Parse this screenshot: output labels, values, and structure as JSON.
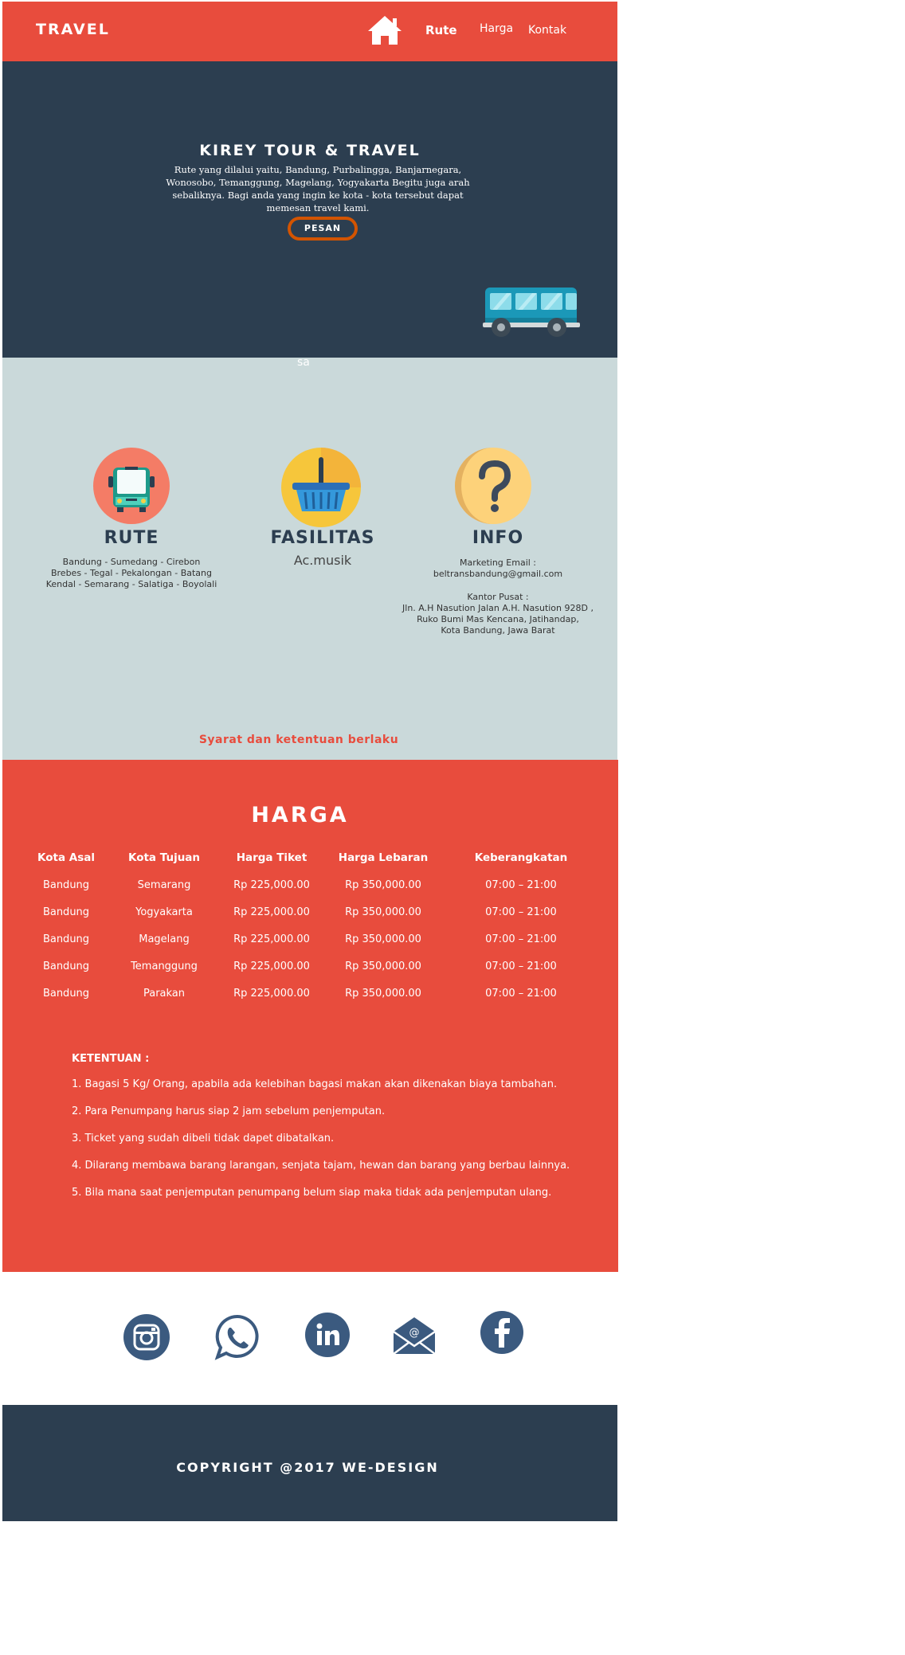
{
  "navbar": {
    "brand": "TRAVEL",
    "home_icon": "home-icon",
    "links": [
      "Rute",
      "Harga",
      "Kontak"
    ]
  },
  "hero": {
    "title": "KIREY TOUR & TRAVEL",
    "description": "Rute yang dilalui yaitu, Bandung, Purbalingga, Banjarnegara, Wonosobo, Temanggung, Magelang, Yogyakarta Begitu juga arah sebaliknya. Bagi anda yang ingin ke kota - kota tersebut dapat memesan travel kami.",
    "button": "PESAN",
    "illustration": "bus-illustration"
  },
  "stray_text": "sa",
  "services": {
    "rute": {
      "icon": "bus-icon",
      "title": "RUTE",
      "lines": [
        "Bandung - Sumedang - Cirebon",
        "Brebes - Tegal - Pekalongan - Batang",
        "Kendal - Semarang - Salatiga - Boyolali"
      ]
    },
    "fasilitas": {
      "icon": "basket-icon",
      "title": "FASILITAS",
      "subtitle": "Ac.musik"
    },
    "info": {
      "icon": "question-icon",
      "title": "INFO",
      "email_label": "Marketing Email :",
      "email": "beltransbandung@gmail.com",
      "office_label": "Kantor Pusat :",
      "address_lines": [
        "Jln. A.H Nasution Jalan A.H. Nasution 928D ,",
        "Ruko Bumi Mas Kencana, Jatihandap,",
        "Kota Bandung, Jawa Barat"
      ]
    },
    "terms_note": "Syarat dan ketentuan berlaku"
  },
  "pricing": {
    "title": "HARGA",
    "headers": [
      "Kota Asal",
      "Kota Tujuan",
      "Harga Tiket",
      "Harga Lebaran",
      "Keberangkatan"
    ],
    "rows": [
      [
        "Bandung",
        "Semarang",
        "Rp 225,000.00",
        "Rp  350,000.00",
        "07:00 – 21:00"
      ],
      [
        "Bandung",
        "Yogyakarta",
        "Rp 225,000.00",
        "Rp  350,000.00",
        "07:00 – 21:00"
      ],
      [
        "Bandung",
        "Magelang",
        "Rp 225,000.00",
        "Rp  350,000.00",
        "07:00 – 21:00"
      ],
      [
        "Bandung",
        "Temanggung",
        "Rp 225,000.00",
        "Rp  350,000.00",
        "07:00 – 21:00"
      ],
      [
        "Bandung",
        "Parakan",
        "Rp 225,000.00",
        "Rp  350,000.00",
        "07:00 – 21:00"
      ]
    ],
    "rules_title": "KETENTUAN :",
    "rules": [
      "1. Bagasi 5 Kg/ Orang, apabila ada kelebihan bagasi makan akan dikenakan biaya tambahan.",
      "2. Para Penumpang harus siap 2 jam sebelum penjemputan.",
      "3. Ticket yang sudah dibeli tidak dapet dibatalkan.",
      "4. Dilarang membawa barang larangan, senjata tajam, hewan dan barang yang berbau lainnya.",
      "5. Bila mana saat penjemputan penumpang belum siap maka tidak ada penjemputan ulang."
    ]
  },
  "social": [
    "instagram-icon",
    "whatsapp-icon",
    "linkedin-icon",
    "mail-icon",
    "facebook-icon"
  ],
  "footer": {
    "copyright": "COPYRIGHT @2017 WE-DESIGN"
  },
  "colors": {
    "red": "#e84c3d",
    "navy": "#2c3e50",
    "gray_blue": "#cad9da",
    "orange": "#d35400",
    "social_blue": "#3b5a7f"
  }
}
